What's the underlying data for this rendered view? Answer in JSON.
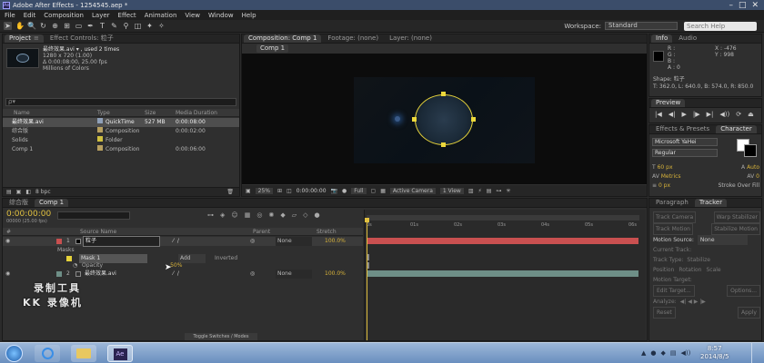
{
  "window": {
    "title": "Adobe After Effects - 1254545.aep *",
    "minimize": "–",
    "maximize": "□",
    "close": "✕"
  },
  "menu": [
    "File",
    "Edit",
    "Composition",
    "Layer",
    "Effect",
    "Animation",
    "View",
    "Window",
    "Help"
  ],
  "workspace": {
    "label": "Workspace:",
    "value": "Standard",
    "search_placeholder": "Search Help"
  },
  "project": {
    "tab": "Project",
    "tab2": "Effect Controls: 粒子",
    "preview_name": "最终效果.avi ▾ , used 2 times",
    "preview_info": [
      "1280 x 720 (1.00)",
      "Δ 0:00:08:00, 25.00 fps",
      "Millions of Colors"
    ],
    "search_placeholder": "ρ▾",
    "columns": [
      "Name",
      "Type",
      "Size",
      "Media Duration"
    ],
    "items": [
      {
        "name": "最终效果.avi",
        "type": "QuickTime",
        "size": "527 MB",
        "duration": "0:00:08:00",
        "color": "#8fa0b8",
        "selected": true
      },
      {
        "name": "综合版",
        "type": "Composition",
        "size": "",
        "duration": "0:00:02:00",
        "color": "#b8a060",
        "selected": false
      },
      {
        "name": "Solids",
        "type": "Folder",
        "size": "",
        "duration": "",
        "color": "#d0c040",
        "selected": false
      },
      {
        "name": "Comp 1",
        "type": "Composition",
        "size": "",
        "duration": "0:00:06:00",
        "color": "#b8a060",
        "selected": false
      }
    ],
    "bpc": "8 bpc"
  },
  "composition": {
    "tab": "Composition: Comp 1",
    "tab_footage": "Footage: (none)",
    "tab_layer": "Layer: (none)",
    "comp_name": "Comp 1",
    "zoom": "25%",
    "timecode": "0:00:00:00",
    "resolution": "Full",
    "camera": "Active Camera",
    "views": "1 View"
  },
  "info": {
    "tab": "Info",
    "tab2": "Audio",
    "channels": [
      "R :",
      "G :",
      "B :",
      "A : 0"
    ],
    "coords": [
      "X : -476",
      "Y : 998"
    ],
    "shape": "Shape: 粒子",
    "shape_dims": "T: 362.0, L: 640.0, B: 574.0, R: 850.0"
  },
  "preview": {
    "tab": "Preview",
    "buttons": [
      "|◀",
      "◀|",
      "▶",
      "|▶",
      "▶|",
      "◀))",
      "⟳",
      "⏏"
    ]
  },
  "effects": {
    "tab": "Effects & Presets",
    "tab2": "Character",
    "font": "Microsoft YaHei",
    "style": "Regular",
    "size": "60 px",
    "leading": "Auto",
    "tracking": "0",
    "kern": "Metrics",
    "stroke_width": "0 px",
    "stroke_type": "Stroke Over Fill"
  },
  "tracker": {
    "tab": "Paragraph",
    "tab2": "Tracker",
    "buttons": [
      "Track Camera",
      "Warp Stabilizer",
      "Track Motion",
      "Stabilize Motion"
    ],
    "motion_source_label": "Motion Source:",
    "motion_source": "None",
    "current_track": "Current Track:",
    "track_type": "Track Type:",
    "track_type_value": "Stabilize",
    "checks": [
      "Position",
      "Rotation",
      "Scale"
    ],
    "motion_target": "Motion Target:",
    "edit_target": "Edit Target...",
    "options": "Options...",
    "analyze": "Analyze:",
    "reset": "Reset",
    "apply": "Apply"
  },
  "timeline": {
    "tab1": "综合版",
    "tab2": "Comp 1",
    "timecode": "0:00:00:00",
    "frames": "00000 (25.00 fps)",
    "columns": [
      "#",
      "Source Name",
      "Parent",
      "Stretch"
    ],
    "ruler": [
      "0s",
      "01s",
      "02s",
      "03s",
      "04s",
      "05s",
      "06s"
    ],
    "layers": [
      {
        "num": "1",
        "name": "粒子",
        "parent": "None",
        "stretch": "100.0%",
        "bar_color": "#c95050"
      },
      {
        "num": "2",
        "name": "最终效果.avi",
        "parent": "None",
        "stretch": "100.0%",
        "bar_color": "#6e8f87"
      }
    ],
    "masks_label": "Masks",
    "mask_name": "Mask 1",
    "mask_mode": "Add",
    "inverted": "Inverted",
    "opacity_label": "Opacity",
    "opacity_value": "50%",
    "toggle": "Toggle Switches / Modes"
  },
  "watermark": [
    "录制工具",
    "KK 录像机"
  ],
  "taskbar": {
    "time": "8:57",
    "date": "2014/8/5",
    "ae_label": "Ae"
  }
}
